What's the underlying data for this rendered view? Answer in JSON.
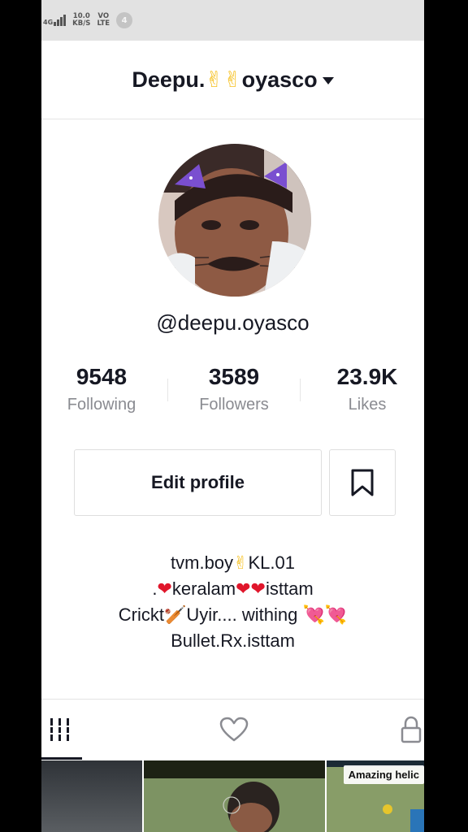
{
  "status_bar": {
    "network": "4G",
    "speed_value": "10.0",
    "speed_unit": "KB/S",
    "volte_top": "VO",
    "volte_bottom": "LTE",
    "notification_count": "4"
  },
  "header": {
    "name_prefix": "Deepu.",
    "name_emojis": "✌✌",
    "name_suffix": "oyasco"
  },
  "profile": {
    "username": "@deepu.oyasco"
  },
  "stats": {
    "following": {
      "value": "9548",
      "label": "Following"
    },
    "followers": {
      "value": "3589",
      "label": "Followers"
    },
    "likes": {
      "value": "23.9K",
      "label": "Likes"
    }
  },
  "actions": {
    "edit_profile": "Edit profile"
  },
  "bio": {
    "line1_a": "tvm.boy",
    "line1_emoji": "✌",
    "line1_b": "KL.01",
    "line2_a": ".",
    "line2_b": "keralam",
    "line2_c": "isttam",
    "line3_a": "Crickt",
    "line3_emoji": "🏏",
    "line3_b": "Uyir.... withing",
    "line4": "Bullet.Rx.isttam"
  },
  "tabs": [
    "videos-tab",
    "liked-tab",
    "private-tab"
  ],
  "thumbnails": {
    "third_label": "Amazing helic"
  },
  "colors": {
    "text": "#161823",
    "secondary": "#8a8b91",
    "heart": "#e0162b"
  }
}
